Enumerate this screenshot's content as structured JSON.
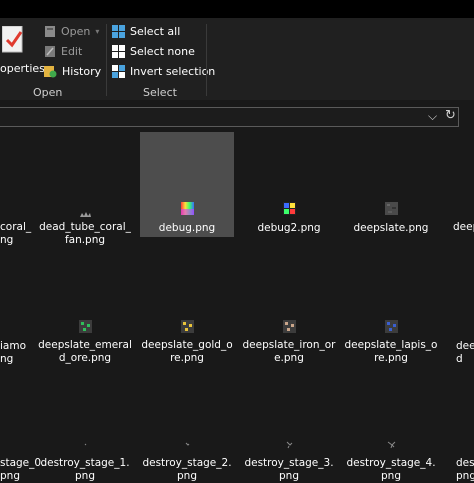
{
  "ribbon": {
    "properties_label": "operties",
    "open_label": "Open",
    "edit_label": "Edit",
    "history_label": "History",
    "open_group": "Open",
    "select_all_label": "Select all",
    "select_none_label": "Select none",
    "invert_selection_label": "Invert selection",
    "select_group": "Select"
  },
  "files": {
    "row1": [
      {
        "name": "dead_tube_coral_\nfan.png"
      },
      {
        "name": "debug.png"
      },
      {
        "name": "debug2.png"
      },
      {
        "name": "deepslate.png"
      }
    ],
    "row2": [
      {
        "name": "deepslate_emeral\nd_ore.png"
      },
      {
        "name": "deepslate_gold_o\nre.png"
      },
      {
        "name": "deepslate_iron_or\ne.png"
      },
      {
        "name": "deepslate_lapis_o\nre.png"
      }
    ],
    "row3": [
      {
        "name": "destroy_stage_1.\npng"
      },
      {
        "name": "destroy_stage_2.\npng"
      },
      {
        "name": "destroy_stage_3.\npng"
      },
      {
        "name": "destroy_stage_4.\npng"
      }
    ],
    "left_partial": [
      "coral_\nng",
      "iamo\nng",
      "stage_0.\npng"
    ],
    "right_partial": [
      "deep",
      "deep\nd",
      "dest\npng"
    ]
  }
}
